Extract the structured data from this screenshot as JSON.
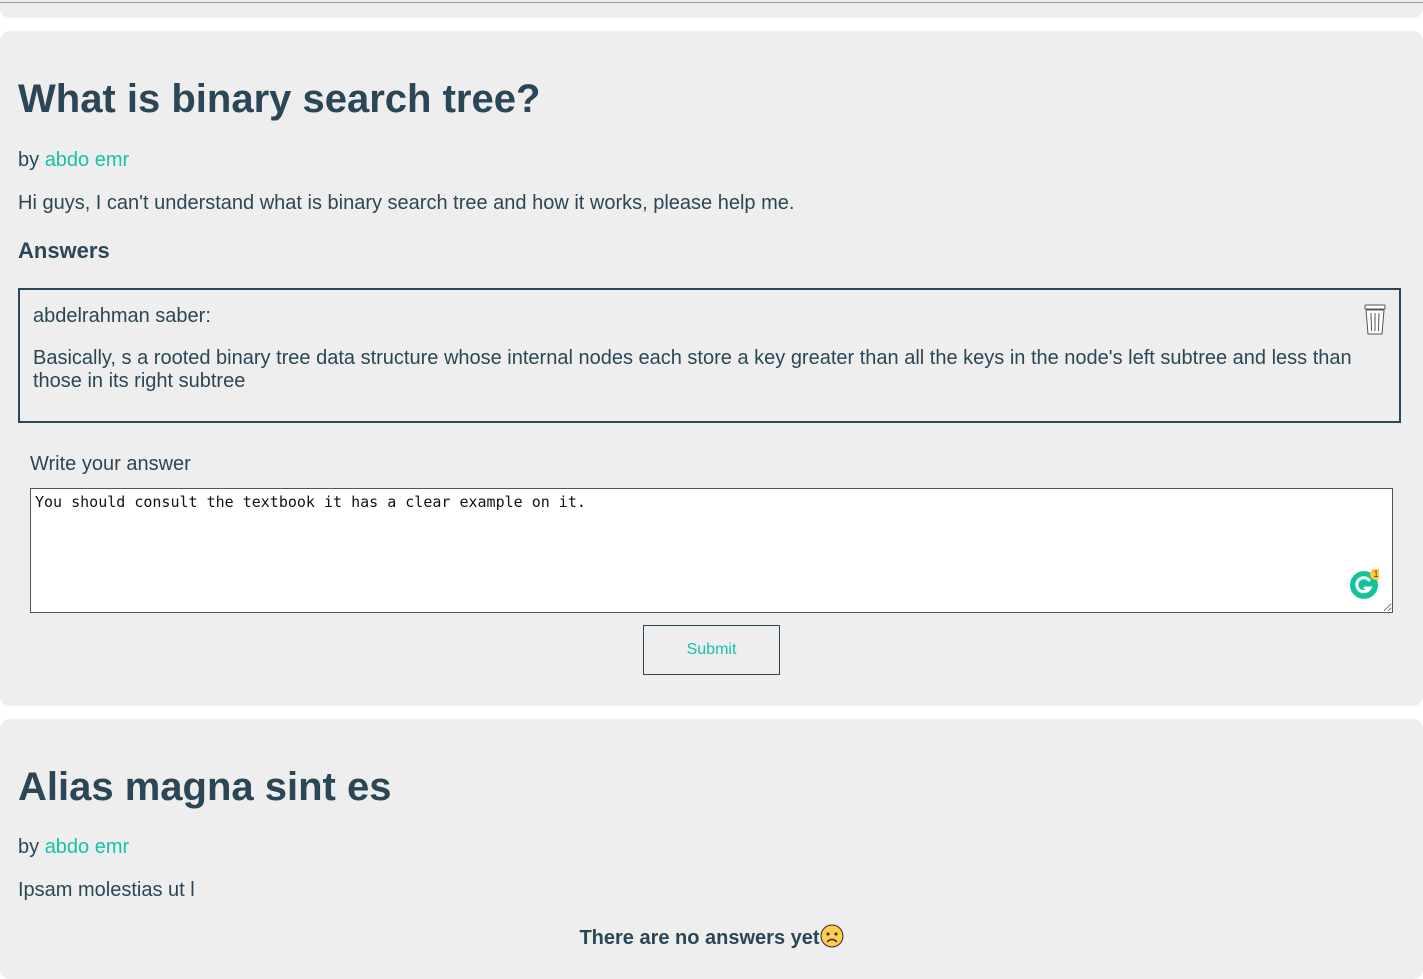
{
  "questions": [
    {
      "title": "What is binary search tree?",
      "by_prefix": "by",
      "author": "abdo emr",
      "body": "Hi guys, I can't understand what is binary search tree and how it works, please help me.",
      "answers_heading": "Answers",
      "answers": [
        {
          "author": "abdelrahman saber:",
          "text": "Basically, s a rooted binary tree data structure whose internal nodes each store a key greater than all the keys in the node's left subtree and less than those in its right subtree",
          "delete_icon": "trash-icon"
        }
      ],
      "write_label": "Write your answer",
      "answer_input_value": "You should consult the textbook it has a clear example on it.",
      "grammarly_badge_count": "1",
      "submit_label": "Submit"
    },
    {
      "title": "Alias magna sint es",
      "by_prefix": "by",
      "author": "abdo emr",
      "body": "Ipsam molestias ut l",
      "no_answers_text": "There are no answers yet",
      "no_answers_icon": "sad-face-icon"
    }
  ],
  "colors": {
    "card_bg": "#eeeeee",
    "text": "#2b4656",
    "accent": "#16c1ad",
    "grammarly": "#15c39a"
  }
}
